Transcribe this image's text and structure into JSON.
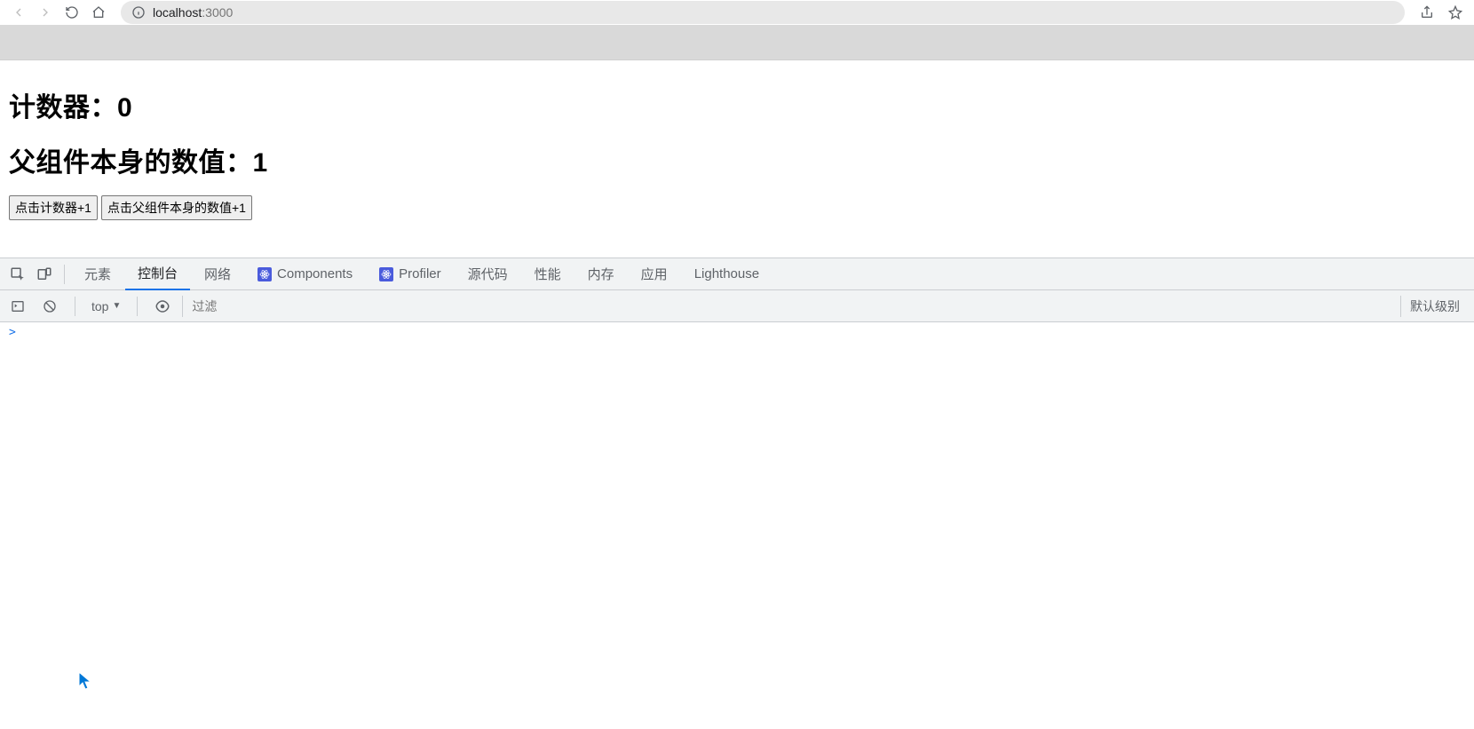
{
  "browser": {
    "url_host": "localhost",
    "url_port": ":3000"
  },
  "page": {
    "counter_label": "计数器：",
    "counter_value": "0",
    "parent_label": "父组件本身的数值：",
    "parent_value": "1",
    "btn_counter": "点击计数器+1",
    "btn_parent": "点击父组件本身的数值+1"
  },
  "devtools": {
    "tabs": {
      "elements": "元素",
      "console": "控制台",
      "network": "网络",
      "components": "Components",
      "profiler": "Profiler",
      "sources": "源代码",
      "performance": "性能",
      "memory": "内存",
      "application": "应用",
      "lighthouse": "Lighthouse"
    },
    "subbar": {
      "context": "top",
      "filter_placeholder": "过滤",
      "levels": "默认级别"
    },
    "prompt": ">"
  }
}
